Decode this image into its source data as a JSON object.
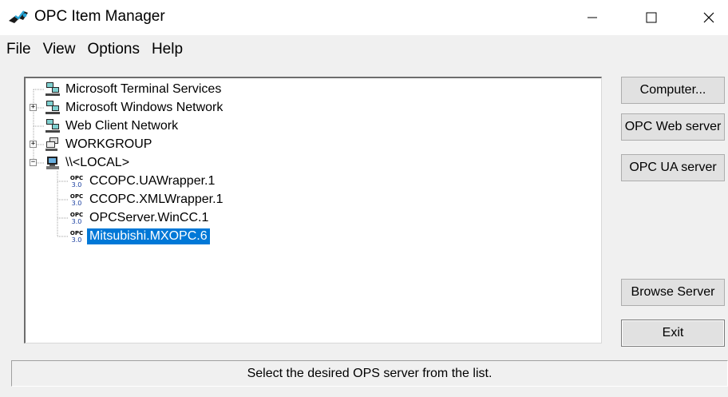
{
  "window": {
    "title": "OPC Item Manager",
    "controls": {
      "minimize": "–",
      "maximize": "☐",
      "close": "✕"
    },
    "app_icon": "opc-app-icon"
  },
  "menu": [
    "File",
    "View",
    "Options",
    "Help"
  ],
  "tree": {
    "nodes": [
      {
        "label": "Microsoft Terminal Services",
        "icon": "network-computers-icon",
        "expander": ""
      },
      {
        "label": "Microsoft Windows Network",
        "icon": "network-computers-icon",
        "expander": "+"
      },
      {
        "label": "Web Client Network",
        "icon": "network-computers-icon",
        "expander": ""
      },
      {
        "label": "WORKGROUP",
        "icon": "workgroup-icon",
        "expander": "+"
      },
      {
        "label": "\\\\<LOCAL>",
        "icon": "computer-icon",
        "expander": "−"
      },
      {
        "label": "CCOPC.UAWrapper.1",
        "icon": "opc-server-icon",
        "badge": "OPC",
        "version": "3.0"
      },
      {
        "label": "CCOPC.XMLWrapper.1",
        "icon": "opc-server-icon",
        "badge": "OPC",
        "version": "3.0"
      },
      {
        "label": "OPCServer.WinCC.1",
        "icon": "opc-server-icon",
        "badge": "OPC",
        "version": "3.0"
      },
      {
        "label": "Mitsubishi.MXOPC.6",
        "icon": "opc-server-icon",
        "badge": "OPC",
        "version": "3.0",
        "selected": true
      }
    ],
    "selection_color": "#0078d7"
  },
  "buttons": {
    "computer": "Computer...",
    "opc_web_server": "OPC Web server",
    "opc_ua_server": "OPC UA server",
    "browse_server": "Browse Server",
    "exit": "Exit"
  },
  "status": {
    "text": "Select the desired OPS server from the list."
  }
}
